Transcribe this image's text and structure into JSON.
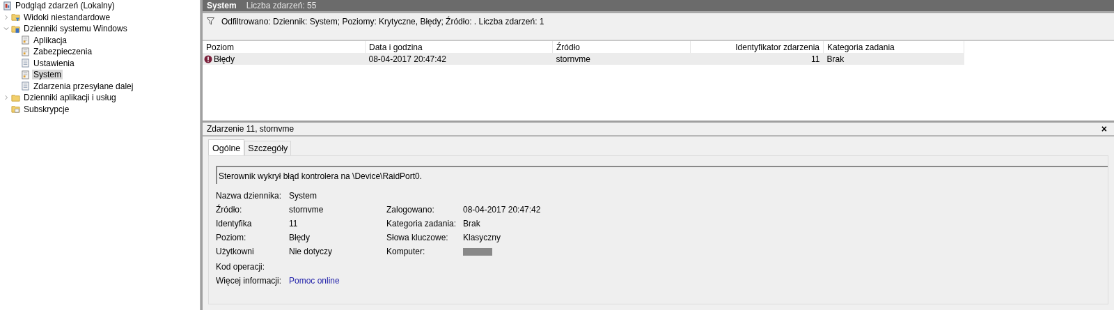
{
  "tree": [
    {
      "label": "Podgląd zdarzeń (Lokalny)",
      "kind": "viewer",
      "selected": false,
      "children": [
        {
          "label": "Widoki niestandardowe",
          "kind": "filter",
          "selected": false,
          "expanded": false
        },
        {
          "label": "Dzienniki systemu Windows",
          "kind": "logfolder",
          "selected": false,
          "expanded": true,
          "children": [
            {
              "label": "Aplikacja",
              "kind": "log",
              "selected": false
            },
            {
              "label": "Zabezpieczenia",
              "kind": "log",
              "selected": false
            },
            {
              "label": "Ustawienia",
              "kind": "page",
              "selected": false
            },
            {
              "label": "System",
              "kind": "log",
              "selected": true
            },
            {
              "label": "Zdarzenia przesyłane dalej",
              "kind": "page",
              "selected": false
            }
          ]
        },
        {
          "label": "Dzienniki aplikacji i usług",
          "kind": "folder",
          "selected": false,
          "expanded": false
        },
        {
          "label": "Subskrypcje",
          "kind": "subscription",
          "selected": false
        }
      ]
    }
  ],
  "log_header": {
    "title": "System",
    "count": "Liczba zdarzeń: 55"
  },
  "filter": "Odfiltrowano: Dziennik: System; Poziomy: Krytyczne, Błędy; Źródło: . Liczba zdarzeń: 1",
  "table": {
    "columns": [
      "Poziom",
      "Data i godzina",
      "Źródło",
      "Identyfikator zdarzenia",
      "Kategoria zadania"
    ],
    "rows": [
      {
        "selected": true,
        "kind": "error",
        "cells": [
          "Błędy",
          "08-04-2017 20:47:42",
          "stornvme",
          "11",
          "Brak"
        ]
      }
    ]
  },
  "details": {
    "title": "Zdarzenie 11, stornvme",
    "close": "×",
    "tabs": [
      {
        "label": "Ogólne",
        "selected": true
      },
      {
        "label": "Szczegóły",
        "selected": false
      }
    ],
    "message": "Sterownik wykrył błąd kontrolera na \\Device\\RaidPort0.",
    "fields": [
      [
        {
          "label": "Nazwa dziennika:",
          "value": "System"
        }
      ],
      [
        {
          "label": "Źródło:",
          "value": "stornvme"
        },
        {
          "label": "Zalogowano:",
          "value": "08-04-2017 20:47:42"
        }
      ],
      [
        {
          "label": "Identyfika",
          "value": "11"
        },
        {
          "label": "Kategoria zadania:",
          "value": "Brak"
        }
      ],
      [
        {
          "label": "Poziom:",
          "value": "Błędy"
        },
        {
          "label": "Słowa kluczowe:",
          "value": "Klasyczny"
        }
      ],
      [
        {
          "label": "Użytkowni",
          "value": "Nie dotyczy"
        },
        {
          "label": "Komputer:",
          "kind": "redacted"
        }
      ],
      [
        {
          "label": "Kod operacji:"
        }
      ],
      [
        {
          "label": "Więcej informacji:",
          "value": "Pomoc online",
          "kind": "link"
        }
      ]
    ]
  }
}
